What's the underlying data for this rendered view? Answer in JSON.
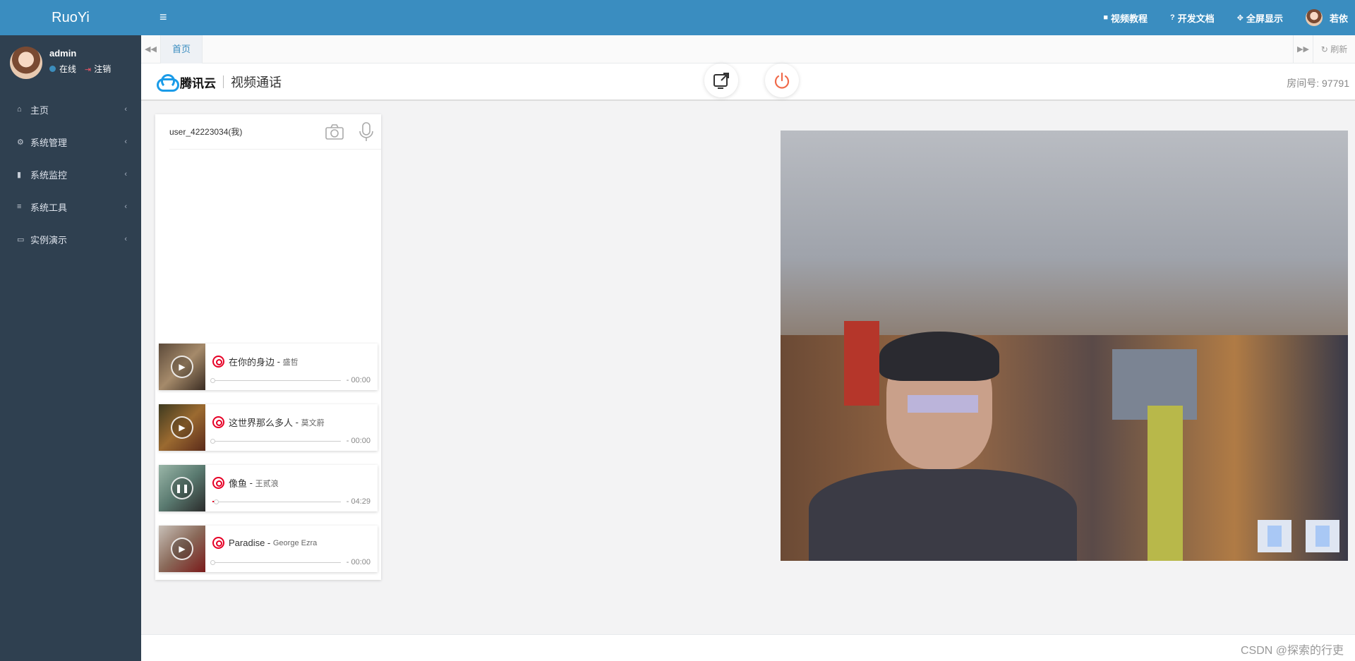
{
  "app": {
    "brand": "RuoYi"
  },
  "user_panel": {
    "username": "admin",
    "status": "在线",
    "logout": "注销"
  },
  "sidebar": {
    "items": [
      {
        "icon": "home-icon",
        "glyph": "⌂",
        "label": "主页"
      },
      {
        "icon": "gear-icon",
        "glyph": "⚙",
        "label": "系统管理"
      },
      {
        "icon": "video-camera-icon",
        "glyph": "▮",
        "label": "系统监控"
      },
      {
        "icon": "bars-icon",
        "glyph": "≡",
        "label": "系统工具"
      },
      {
        "icon": "desktop-icon",
        "glyph": "▭",
        "label": "实例演示"
      }
    ]
  },
  "topbar": {
    "video_tutorial": "视频教程",
    "dev_docs": "开发文档",
    "fullscreen": "全屏显示",
    "user_name": "若依"
  },
  "tabs": {
    "home": "首页",
    "refresh": "刷新"
  },
  "video_call": {
    "brand": "腾讯云",
    "title": "视频通话",
    "room_label": "房间号: 97791",
    "local_user": "user_42223034(我)"
  },
  "songs": [
    {
      "title": "在你的身边",
      "artist": "盛哲",
      "time": "- 00:00",
      "progress": 0,
      "playing": false
    },
    {
      "title": "这世界那么多人",
      "artist": "莫文蔚",
      "time": "- 00:00",
      "progress": 0,
      "playing": false
    },
    {
      "title": "像鱼",
      "artist": "王贰浪",
      "time": "- 04:29",
      "progress": 0.03,
      "playing": true
    },
    {
      "title": "Paradise",
      "artist": "George Ezra",
      "time": "- 00:00",
      "progress": 0,
      "playing": false
    }
  ],
  "footer": {
    "watermark": "CSDN @探索的行吏"
  }
}
